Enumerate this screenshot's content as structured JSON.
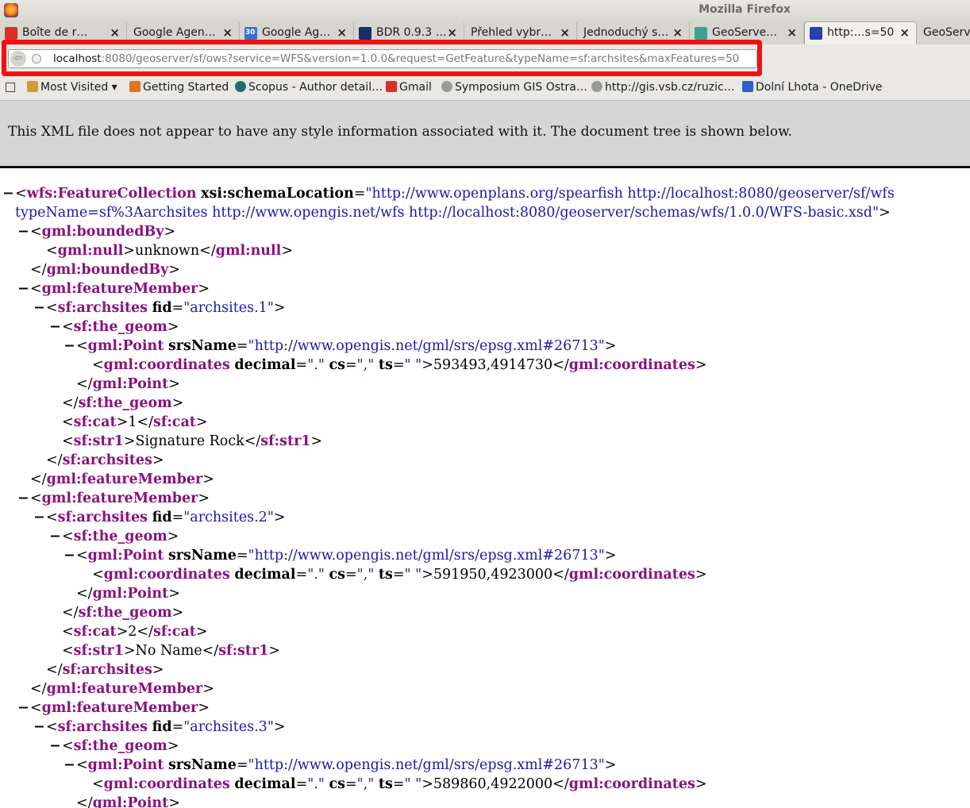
{
  "window": {
    "title": "Mozilla Firefox"
  },
  "tabs": [
    {
      "label": "Boîte de r…",
      "icon": "gmail-icon",
      "color": "#d93025"
    },
    {
      "label": "Google Agen…",
      "icon": "none"
    },
    {
      "label": "Google Ag…",
      "icon": "calendar-icon",
      "color": "#3b6fd4",
      "badge": "30"
    },
    {
      "label": "BDR 0.9.3 …",
      "icon": "bdr-icon",
      "color": "#1b2b6b"
    },
    {
      "label": "Přehled vybr…",
      "icon": "none"
    },
    {
      "label": "Jednoduchý s…",
      "icon": "none"
    },
    {
      "label": "GeoServe…",
      "icon": "geoserver-icon",
      "color": "#3aa58f"
    },
    {
      "label": "http:…s=50",
      "icon": "xml-icon",
      "color": "#2742a8",
      "active": true
    },
    {
      "label": "GeoServ",
      "icon": "none"
    }
  ],
  "urlbar": {
    "host": "localhost",
    "rest": ":8080/geoserver/sf/ows?service=WFS&version=1.0.0&request=GetFeature&typeName=sf:archsites&maxFeatures=50"
  },
  "bookmarks": [
    {
      "label": "Most Visited ▾",
      "icon": "folder-icon",
      "color": "#d89a2c"
    },
    {
      "label": "Getting Started",
      "icon": "firefox-icon",
      "color": "#e5731c"
    },
    {
      "label": "Scopus - Author detail…",
      "icon": "scopus-icon",
      "color": "#1f6e6e"
    },
    {
      "label": "Gmail",
      "icon": "gmail-icon",
      "color": "#d93025"
    },
    {
      "label": "Symposium GIS Ostra…",
      "icon": "globe-icon",
      "color": "#9a9a9a"
    },
    {
      "label": "http://gis.vsb.cz/ruzic…",
      "icon": "globe-icon",
      "color": "#9a9a9a"
    },
    {
      "label": "Dolní Lhota - OneDrive",
      "icon": "onedrive-icon",
      "color": "#2a62c9"
    }
  ],
  "banner": {
    "text": "This XML file does not appear to have any style information associated with it. The document tree is shown below."
  },
  "xml": {
    "root_tag": "wfs:FeatureCollection",
    "root_attr_name": "xsi:schemaLocation",
    "root_attr_value_1": "\"http://www.openplans.org/spearfish http://localhost:8080/geoserver/sf/wfs",
    "root_attr_value_2": "typeName=sf%3Aarchsites http://www.opengis.net/wfs http://localhost:8080/geoserver/schemas/wfs/1.0.0/WFS-basic.xsd\"",
    "bounded_by": "gml:boundedBy",
    "null_tag": "gml:null",
    "null_value": "unknown",
    "member_tag": "gml:featureMember",
    "feature_tag": "sf:archsites",
    "fid_attr": "fid",
    "geom_tag": "sf:the_geom",
    "point_tag": "gml:Point",
    "srs_attr": "srsName",
    "srs_value": "\"http://www.opengis.net/gml/srs/epsg.xml#26713\"",
    "coords_tag": "gml:coordinates",
    "decimal_attr": "decimal",
    "decimal_value": "\".\"",
    "cs_attr": "cs",
    "cs_value": "\",\"",
    "ts_attr": "ts",
    "ts_value": "\" \"",
    "cat_tag": "sf:cat",
    "str1_tag": "sf:str1",
    "features": [
      {
        "fid": "\"archsites.1\"",
        "coords": "593493,4914730",
        "cat": "1",
        "str1": "Signature Rock"
      },
      {
        "fid": "\"archsites.2\"",
        "coords": "591950,4923000",
        "cat": "2",
        "str1": "No Name"
      },
      {
        "fid": "\"archsites.3\"",
        "coords": "589860,4922000"
      }
    ]
  }
}
